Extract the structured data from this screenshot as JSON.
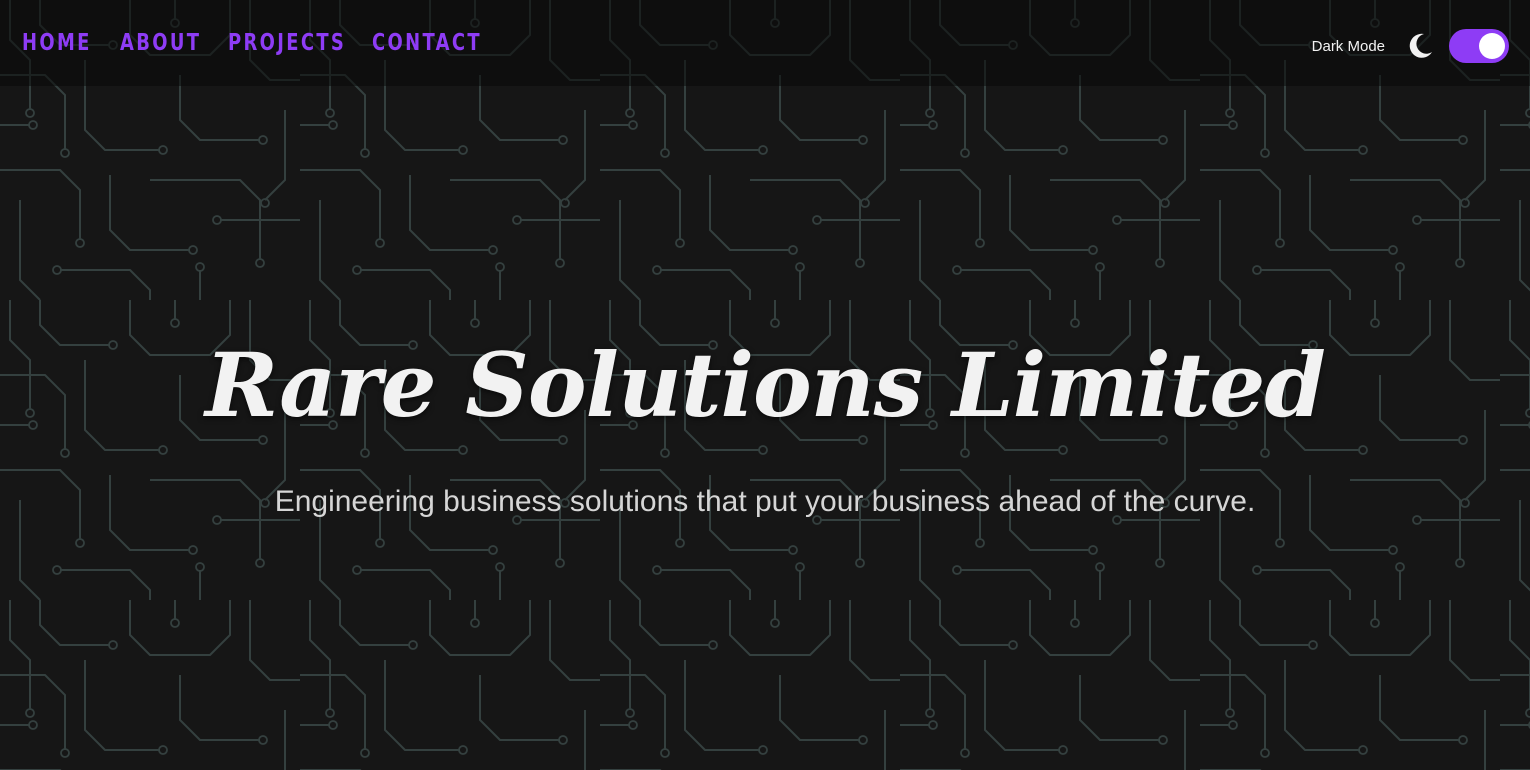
{
  "nav": {
    "items": [
      {
        "label": "HOME"
      },
      {
        "label": "ABOUT"
      },
      {
        "label": "PROJECTS"
      },
      {
        "label": "CONTACT"
      }
    ]
  },
  "theme": {
    "label": "Dark Mode",
    "icon": "moon-icon",
    "enabled": true
  },
  "hero": {
    "title": "Rare Solutions Limited",
    "subtitle": "Engineering business solutions that put your business ahead of the curve."
  },
  "colors": {
    "accent": "#8e3cf5",
    "background": "#161616",
    "circuit": "#3a4548",
    "text": "#f2f2f2"
  }
}
